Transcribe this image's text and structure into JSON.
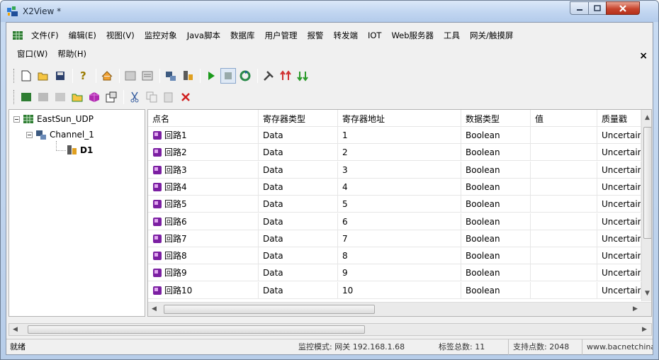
{
  "window": {
    "title": "X2View *"
  },
  "menu": {
    "row1": [
      "文件(F)",
      "编辑(E)",
      "视图(V)",
      "监控对象",
      "Java脚本",
      "数据库",
      "用户管理",
      "报警",
      "转发端",
      "IOT",
      "Web服务器",
      "工具",
      "网关/触摸屏"
    ],
    "row2": [
      "窗口(W)",
      "帮助(H)"
    ],
    "mdi_close": "×"
  },
  "toolbar1": [
    "new-icon",
    "open-icon",
    "save-icon",
    "help-icon",
    "home-icon",
    "grid-view-icon",
    "report-icon",
    "channel-config-icon",
    "device-config-icon",
    "run-icon",
    "stop-icon",
    "refresh-icon",
    "tools-icon",
    "upload-icon",
    "download-icon"
  ],
  "toolbar2": [
    "add-tag-icon",
    "edit-tag-icon",
    "delete-tag-icon",
    "open-folder-icon",
    "cube-icon",
    "properties-icon",
    "cut-icon",
    "copy-icon",
    "paste-icon",
    "delete-icon"
  ],
  "tree": {
    "root": "EastSun_UDP",
    "channel": "Channel_1",
    "device": "D1"
  },
  "grid": {
    "columns": [
      "点名",
      "寄存器类型",
      "寄存器地址",
      "数据类型",
      "值",
      "质量戳"
    ],
    "rows": [
      {
        "name": "回路1",
        "reg_type": "Data",
        "address": "1",
        "data_type": "Boolean",
        "value": "",
        "quality": "Uncertain"
      },
      {
        "name": "回路2",
        "reg_type": "Data",
        "address": "2",
        "data_type": "Boolean",
        "value": "",
        "quality": "Uncertain"
      },
      {
        "name": "回路3",
        "reg_type": "Data",
        "address": "3",
        "data_type": "Boolean",
        "value": "",
        "quality": "Uncertain"
      },
      {
        "name": "回路4",
        "reg_type": "Data",
        "address": "4",
        "data_type": "Boolean",
        "value": "",
        "quality": "Uncertain"
      },
      {
        "name": "回路5",
        "reg_type": "Data",
        "address": "5",
        "data_type": "Boolean",
        "value": "",
        "quality": "Uncertain"
      },
      {
        "name": "回路6",
        "reg_type": "Data",
        "address": "6",
        "data_type": "Boolean",
        "value": "",
        "quality": "Uncertain"
      },
      {
        "name": "回路7",
        "reg_type": "Data",
        "address": "7",
        "data_type": "Boolean",
        "value": "",
        "quality": "Uncertain"
      },
      {
        "name": "回路8",
        "reg_type": "Data",
        "address": "8",
        "data_type": "Boolean",
        "value": "",
        "quality": "Uncertain"
      },
      {
        "name": "回路9",
        "reg_type": "Data",
        "address": "9",
        "data_type": "Boolean",
        "value": "",
        "quality": "Uncertain"
      },
      {
        "name": "回路10",
        "reg_type": "Data",
        "address": "10",
        "data_type": "Boolean",
        "value": "",
        "quality": "Uncertain"
      }
    ]
  },
  "status": {
    "ready": "就绪",
    "mode": "监控模式: 网关 192.168.1.68",
    "tag_count": "标签总数: 11",
    "supported_points": "支持点数: 2048",
    "website": "www.bacnetchina.com"
  },
  "colors": {
    "accent": "#3a6ea5",
    "tag_icon": "#7b1fa2",
    "run_green": "#1a9a1a",
    "close_red": "#c7452e"
  }
}
